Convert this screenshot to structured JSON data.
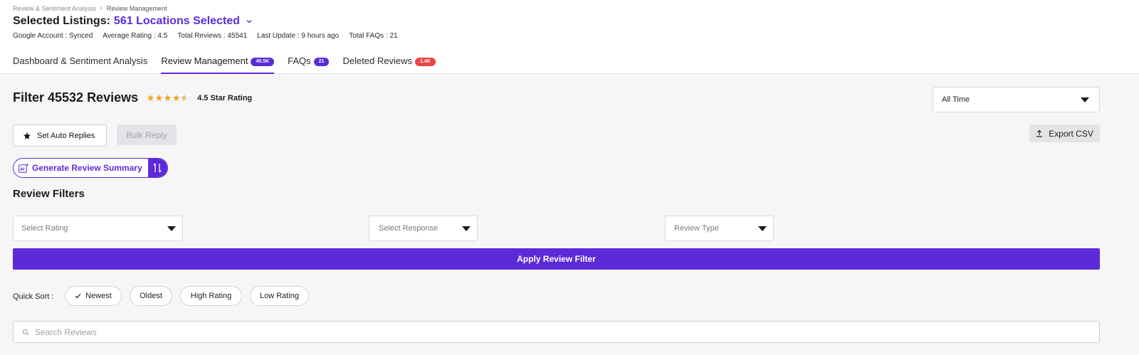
{
  "breadcrumb": {
    "parent": "Review & Sentiment Analysis",
    "separator": "›",
    "current": "Review Management"
  },
  "header": {
    "title_label": "Selected Listings:",
    "title_value": "561 Locations Selected",
    "meta": [
      "Google Account : Synced",
      "Average Rating : 4.5",
      "Total Reviews : 45541",
      "Last Update : 9 hours ago",
      "Total FAQs : 21"
    ]
  },
  "tabs": [
    {
      "label": "Dashboard & Sentiment Analysis",
      "badge": "",
      "active": false
    },
    {
      "label": "Review Management",
      "badge": "45.5K",
      "active": true
    },
    {
      "label": "FAQs",
      "badge": "21",
      "active": false
    },
    {
      "label": "Deleted Reviews",
      "badge": "1.4K",
      "active": false
    }
  ],
  "filter": {
    "title": "Filter 45532 Reviews",
    "rating_value": 4.5,
    "star_label": "4.5 Star Rating",
    "time_range": "All Time"
  },
  "actions": {
    "auto_replies": "Set Auto Replies",
    "bulk_reply": "Bulk Reply",
    "export_csv": "Export CSV",
    "generate_summary": "Generate Review Summary",
    "ai_label": "AI"
  },
  "review_filters": {
    "title": "Review Filters",
    "rating_placeholder": "Select Rating",
    "response_placeholder": "Select Response",
    "type_placeholder": "Review Type",
    "apply_label": "Apply Review Filter"
  },
  "quick_sort": {
    "label": "Quick Sort :",
    "options": [
      "Newest",
      "Oldest",
      "High Rating",
      "Low Rating"
    ],
    "selected": "Newest"
  },
  "search": {
    "placeholder": "Search Reviews"
  },
  "colors": {
    "accent": "#5b2bd9",
    "danger": "#e84545",
    "star": "#f5a623"
  },
  "icons": [
    "chevron-down-icon",
    "star-icon",
    "upload-icon",
    "ai-sparkle-icon",
    "sort-toggle-icon",
    "caret-down-icon",
    "check-icon",
    "search-icon"
  ]
}
